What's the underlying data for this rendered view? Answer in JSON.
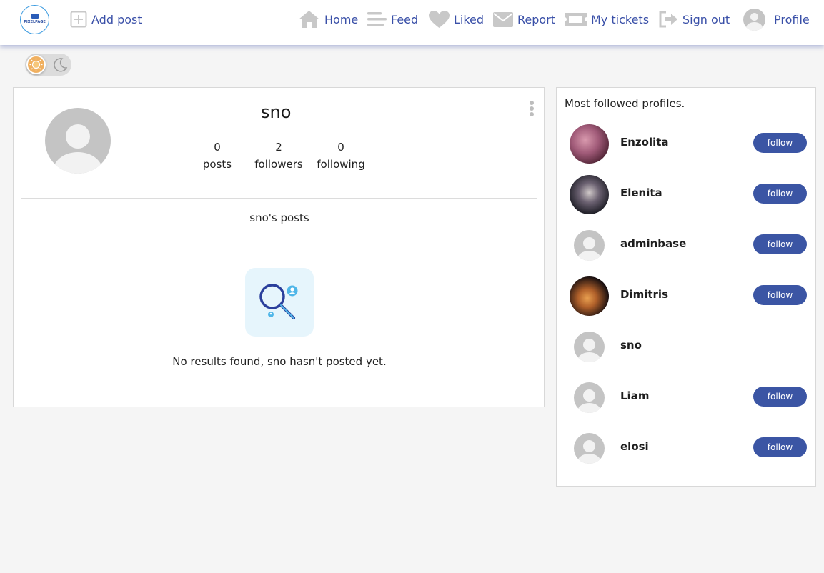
{
  "header": {
    "logo_text": "PIXELPAGE",
    "add_post": "Add post",
    "nav": {
      "home": "Home",
      "feed": "Feed",
      "liked": "Liked",
      "report": "Report",
      "tickets": "My tickets",
      "signout": "Sign out",
      "profile": "Profile"
    }
  },
  "colors": {
    "accent": "#3b55a4",
    "nav_text": "#3a50a8",
    "icon_gray": "#c8c8c8"
  },
  "profile": {
    "username": "sno",
    "stats": [
      {
        "value": "0",
        "label": "posts"
      },
      {
        "value": "2",
        "label": "followers"
      },
      {
        "value": "0",
        "label": "following"
      }
    ],
    "posts_title": "sno's posts",
    "empty_message": "No results found, sno hasn't posted yet."
  },
  "sidebar": {
    "title": "Most followed profiles.",
    "follow_label": "follow",
    "profiles": [
      {
        "name": "Enzolita"
      },
      {
        "name": "Elenita"
      },
      {
        "name": "adminbase"
      },
      {
        "name": "Dimitris"
      },
      {
        "name": "sno"
      },
      {
        "name": "Liam"
      },
      {
        "name": "elosi"
      }
    ]
  }
}
